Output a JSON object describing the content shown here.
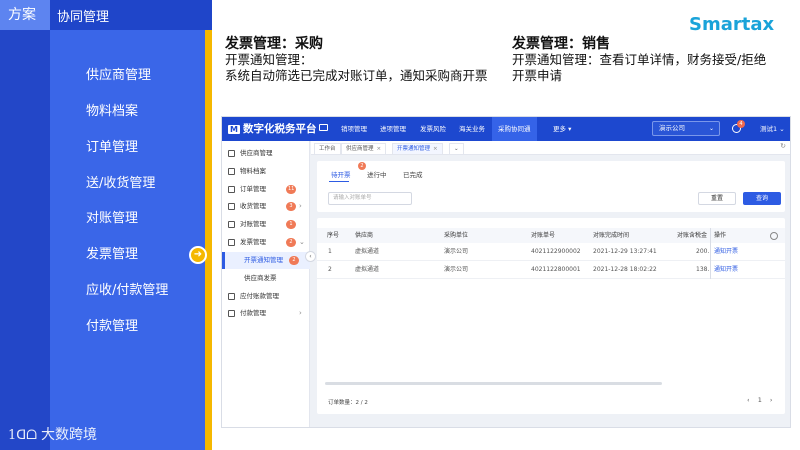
{
  "slide": {
    "tag_primary": "方案",
    "tag_secondary": "协同管理",
    "menu": [
      "供应商管理",
      "物料档案",
      "订单管理",
      "送/收货管理",
      "对账管理",
      "发票管理",
      "应收/付款管理",
      "付款管理"
    ],
    "footer_mark": "1ᗡᗝ",
    "footer_text": "大数跨境",
    "brand": "Smartax"
  },
  "sections": {
    "purchase": {
      "heading": "发票管理：采购",
      "line1": "开票通知管理：",
      "line2": "系统自动筛选已完成对账订单，通知采购商开票"
    },
    "sales": {
      "heading": "发票管理：销售",
      "line1": "开票通知管理：查看订单详情，财务接受/拒绝",
      "line2": "开票申请"
    }
  },
  "app": {
    "logo": "数字化税务平台",
    "logo_mark": "M",
    "nav": [
      "销项管理",
      "进项管理",
      "发票风险",
      "海关业务",
      "采购协同通",
      "更多"
    ],
    "nav_more_caret": "▾",
    "company": "演示公司",
    "bell_badge": "4",
    "user": "测试1",
    "sidebar": [
      {
        "label": "供应商管理"
      },
      {
        "label": "物料档案"
      },
      {
        "label": "订单管理",
        "badge": "11"
      },
      {
        "label": "收货管理",
        "badge": "3"
      },
      {
        "label": "对账管理",
        "badge": "1"
      },
      {
        "label": "发票管理",
        "badge": "2"
      },
      {
        "label": "应付账款管理"
      },
      {
        "label": "付款管理"
      }
    ],
    "sidebar_sub": [
      {
        "label": "开票通知管理",
        "badge": "2"
      },
      {
        "label": "供应商发票"
      }
    ],
    "tabs": [
      "工作台",
      "供应商管理",
      "开票通知管理"
    ],
    "tab_close": "×",
    "tab_more": "⌄",
    "status_tabs": [
      "待开票",
      "进行中",
      "已完成"
    ],
    "status_badge": "2",
    "search_placeholder": "请输入对账单号",
    "btn_reset": "重置",
    "btn_query": "查询",
    "columns": [
      "序号",
      "供应商",
      "采购单位",
      "对账单号",
      "对账完成时间",
      "对账含税金",
      "操作"
    ],
    "rows": [
      [
        "1",
        "虚拟通道",
        "演示公司",
        "4021122900002",
        "2021-12-29 13:27:41",
        "200.",
        "通知开票"
      ],
      [
        "2",
        "虚拟通道",
        "演示公司",
        "4021122800001",
        "2021-12-28 18:02:22",
        "138.",
        "通知开票"
      ]
    ],
    "count_label": "订单数量：",
    "count_value": "2 / 2",
    "pager_prev": "‹",
    "pager_page": "1",
    "pager_next": "›"
  },
  "colors": {
    "slide_blue": "#3a66e8",
    "slide_dark_blue": "#1f45c9",
    "accent_yellow": "#f5b800",
    "app_header": "#1d48cf",
    "primary_button": "#2d5be3",
    "badge": "#f07a57",
    "brand": "#1aa3d9"
  },
  "icons": {
    "arrow": "arrow-right-icon",
    "monitor": "monitor-icon",
    "bell": "bell-icon",
    "settings": "settings-icon",
    "collapse": "chevron-left-icon"
  }
}
